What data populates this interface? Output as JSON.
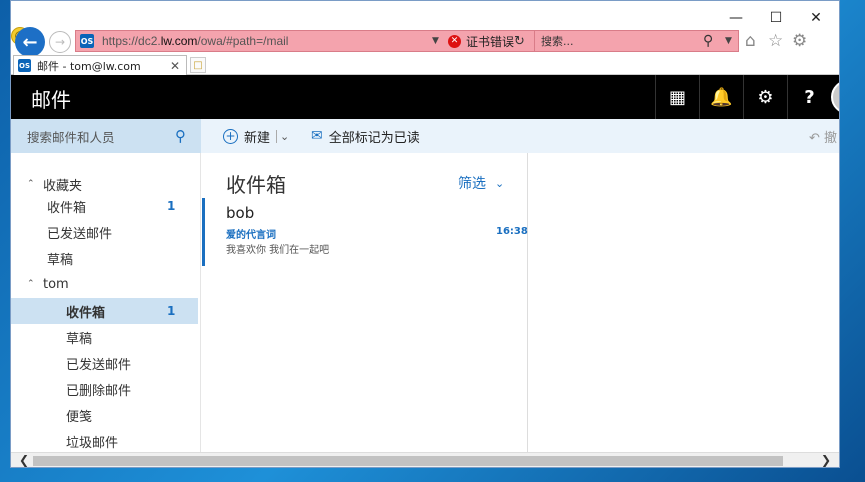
{
  "browser": {
    "address": {
      "url_prefix": "https://dc2.",
      "url_domain": "lw.com",
      "url_suffix": "/owa/#path=/mail",
      "cert_error": "证书错误"
    },
    "search_placeholder": "搜索...",
    "tab": {
      "label": "邮件 - tom@lw.com"
    },
    "favicon_text": "OS"
  },
  "owa": {
    "header_title": "邮件",
    "search_placeholder": "搜索邮件和人员",
    "toolbar": {
      "new_label": "新建",
      "mark_all_read_label": "全部标记为已读",
      "undo_label": "撤"
    },
    "favorites": {
      "group_label": "收藏夹",
      "items": [
        {
          "label": "收件箱",
          "count": "1"
        },
        {
          "label": "已发送邮件"
        },
        {
          "label": "草稿"
        }
      ]
    },
    "account": {
      "group_label": "tom",
      "items": [
        {
          "label": "收件箱",
          "count": "1"
        },
        {
          "label": "草稿"
        },
        {
          "label": "已发送邮件"
        },
        {
          "label": "已删除邮件"
        },
        {
          "label": "便笺"
        },
        {
          "label": "垃圾邮件"
        }
      ]
    },
    "message_list": {
      "title": "收件箱",
      "filter_label": "筛选",
      "messages": [
        {
          "sender": "bob",
          "subject": "爱的代言词",
          "time": "16:38",
          "preview": "我喜欢你 我们在一起吧"
        }
      ]
    }
  },
  "colors": {
    "accent": "#1a6fc0",
    "header_bg": "#000000",
    "selected_bg": "#cce1f2",
    "cert_error_bg": "#f4a3ad"
  }
}
